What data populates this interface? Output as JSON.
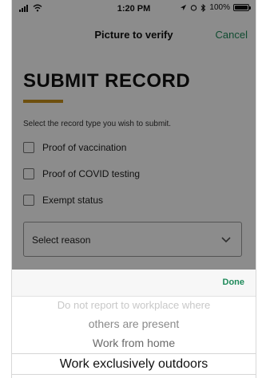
{
  "status_bar": {
    "time": "1:20 PM",
    "battery": "100%"
  },
  "nav": {
    "title": "Picture to verify",
    "cancel_label": "Cancel"
  },
  "form": {
    "heading": "SUBMIT RECORD",
    "instruction": "Select the record type you wish to submit.",
    "options": [
      {
        "label": "Proof of vaccination"
      },
      {
        "label": "Proof of COVID testing"
      },
      {
        "label": "Exempt status"
      }
    ],
    "select_placeholder": "Select reason"
  },
  "picker": {
    "done_label": "Done",
    "items": [
      "Do not report to workplace where",
      "others are present",
      "Work from home",
      "Work exclusively outdoors"
    ]
  },
  "colors": {
    "accent": "#1e8a5a",
    "heading_bar": "#c9921d"
  },
  "icons": {
    "signal": "signal-icon",
    "wifi": "wifi-icon",
    "battery": "battery-icon",
    "chevron": "chevron-down-icon"
  }
}
